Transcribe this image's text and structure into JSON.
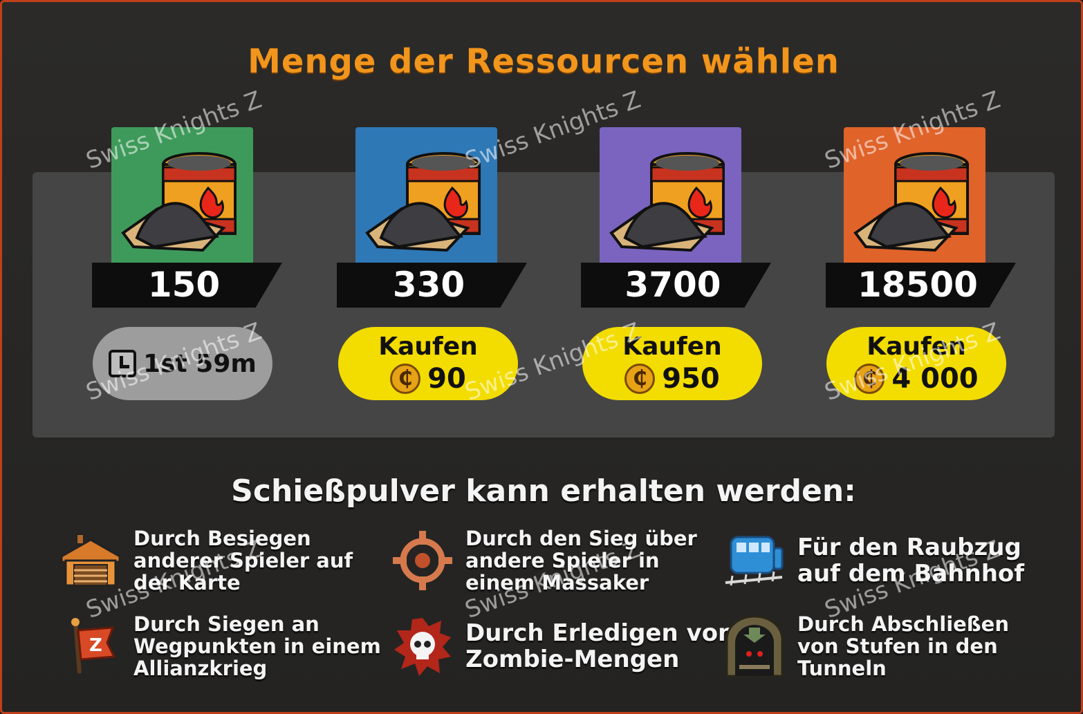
{
  "dialog": {
    "title": "Menge der Ressourcen wählen",
    "resource_icon": "gunpowder-barrel-icon",
    "colors": {
      "title": "#f2951c",
      "frame": "#c0401c",
      "buy_button": "#f3dc00"
    }
  },
  "packs": [
    {
      "amount": "150",
      "card_color": "#3e9a5a",
      "state": "timer",
      "timer_text": "1st 59m",
      "timer_icon": "clock-icon"
    },
    {
      "amount": "330",
      "card_color": "#2e78b6",
      "state": "buy",
      "buy_label": "Kaufen",
      "price": "90",
      "currency_icon": "coin-icon",
      "currency_symbol": "₵"
    },
    {
      "amount": "3700",
      "card_color": "#7a64c0",
      "state": "buy",
      "buy_label": "Kaufen",
      "price": "950",
      "currency_icon": "coin-icon",
      "currency_symbol": "₵"
    },
    {
      "amount": "18500",
      "card_color": "#e0632a",
      "state": "buy",
      "buy_label": "Kaufen",
      "price": "4 000",
      "currency_icon": "coin-icon",
      "currency_symbol": "₵"
    }
  ],
  "sources": {
    "heading": "Schießpulver kann erhalten werden:",
    "items": [
      {
        "icon": "garage-base-icon",
        "text": "Durch Besiegen\nanderer Spieler auf\nder Karte"
      },
      {
        "icon": "crosshair-target-icon",
        "text": "Durch den Sieg über\nandere Spieler in\neinem Massaker"
      },
      {
        "icon": "train-icon",
        "text": "Für den Raubzug\nauf dem Bahnhof"
      },
      {
        "icon": "alliance-flag-icon",
        "text": "Durch Siegen an\nWegpunkten in einem\nAllianzkrieg"
      },
      {
        "icon": "zombie-skull-icon",
        "text": "Durch Erledigen von\nZombie-Mengen"
      },
      {
        "icon": "tunnel-monster-icon",
        "text": "Durch Abschließen\nvon Stufen in den\nTunneln"
      }
    ]
  },
  "watermark": "Swiss Knights Z"
}
